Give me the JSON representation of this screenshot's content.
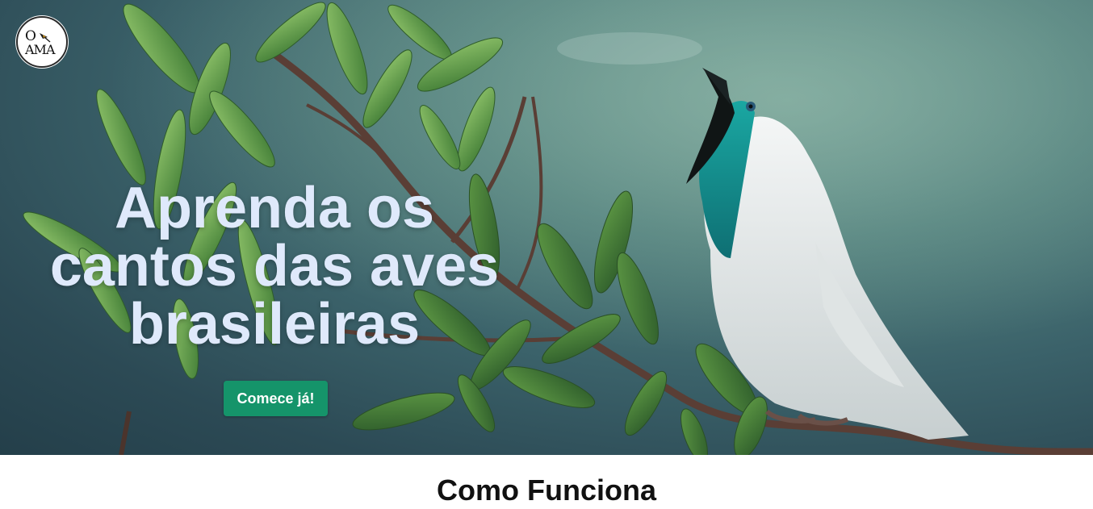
{
  "logo": {
    "alt_name": "site-logo",
    "line1": "O",
    "line2": "AMA"
  },
  "hero": {
    "title": "Aprenda os cantos das aves brasileiras",
    "cta_label": "Comece já!",
    "image_subject": "white bellbird singing on branch"
  },
  "section": {
    "title": "Como Funciona"
  },
  "colors": {
    "title_text": "#dfe9fb",
    "cta_background": "#15946a",
    "cta_text": "#ffffff",
    "section_title": "#111111"
  }
}
